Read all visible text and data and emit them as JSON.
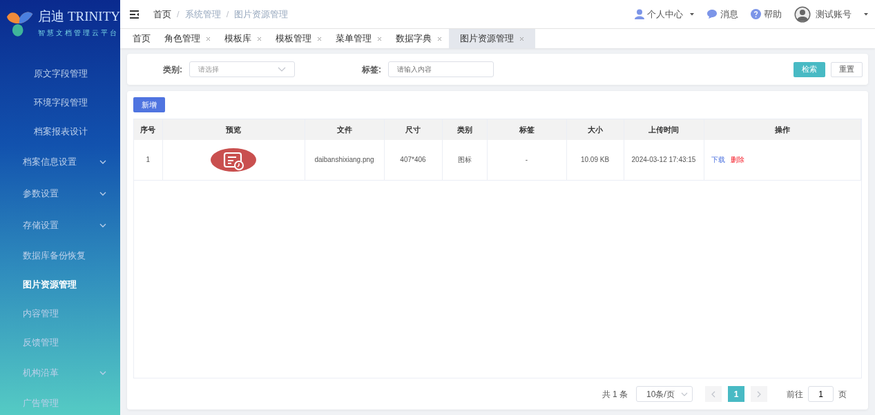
{
  "logo": {
    "name": "启迪",
    "brand": "TRINITY",
    "subtitle": "智慧文档管理云平台"
  },
  "sidebar": {
    "items": [
      {
        "label": "原文字段管理",
        "kind": "child",
        "selected": false
      },
      {
        "label": "环境字段管理",
        "kind": "child",
        "selected": false
      },
      {
        "label": "档案报表设计",
        "kind": "child",
        "selected": false
      },
      {
        "label": "档案信息设置",
        "kind": "parent",
        "selected": false
      },
      {
        "label": "参数设置",
        "kind": "parent",
        "selected": false
      },
      {
        "label": "存储设置",
        "kind": "parent",
        "selected": false
      },
      {
        "label": "数据库备份恢复",
        "kind": "link",
        "selected": false
      },
      {
        "label": "图片资源管理",
        "kind": "link",
        "selected": true
      },
      {
        "label": "内容管理",
        "kind": "link",
        "selected": false
      },
      {
        "label": "反馈管理",
        "kind": "link",
        "selected": false
      },
      {
        "label": "机构沿革",
        "kind": "parent",
        "selected": false
      },
      {
        "label": "广告管理",
        "kind": "link",
        "selected": false
      }
    ]
  },
  "breadcrumb_separator": "/",
  "breadcrumb": [
    {
      "label": "首页",
      "current": false
    },
    {
      "label": "系统管理",
      "current": true
    },
    {
      "label": "图片资源管理",
      "current": true
    }
  ],
  "user_menu": [
    {
      "kind": "person",
      "label": "个人中心",
      "dropdown": true
    },
    {
      "kind": "message",
      "label": "消息",
      "dropdown": false
    },
    {
      "kind": "help",
      "label": "帮助",
      "dropdown": false
    },
    {
      "kind": "account",
      "label": "测试账号",
      "dropdown": true
    }
  ],
  "tabs": [
    {
      "label": "首页",
      "closable": false,
      "selected": false
    },
    {
      "label": "角色管理",
      "closable": true,
      "selected": false
    },
    {
      "label": "模板库",
      "closable": true,
      "selected": false
    },
    {
      "label": "模板管理",
      "closable": true,
      "selected": false
    },
    {
      "label": "菜单管理",
      "closable": true,
      "selected": false
    },
    {
      "label": "数据字典",
      "closable": true,
      "selected": false
    },
    {
      "label": "图片资源管理",
      "closable": true,
      "selected": true
    }
  ],
  "filters": [
    {
      "kind": "select",
      "label": "类别:",
      "placeholder": "请选择"
    },
    {
      "kind": "text",
      "label": "标签:",
      "placeholder": "请输入内容"
    }
  ],
  "search_button": "检索",
  "reset_button": "重置",
  "add_button": "新增",
  "table": {
    "columns": [
      "序号",
      "预览",
      "文件",
      "尺寸",
      "类别",
      "标签",
      "大小",
      "上传时间",
      "操作"
    ],
    "rows": [
      {
        "index": "1",
        "file": "daibanshixiang.png",
        "dimensions": "407*406",
        "category": "图标",
        "tag": "-",
        "file_size": "10.09 KB",
        "uploaded": "2024-03-12 17:43:15",
        "actions": [
          {
            "kind": "download",
            "label": "下载"
          },
          {
            "kind": "delete",
            "label": "删除"
          }
        ]
      }
    ]
  },
  "pagination": {
    "total": "共 1 条",
    "page_size": "10条/页",
    "pages": [
      {
        "label": "1",
        "selected": true
      }
    ],
    "goto_label": "前往",
    "goto_value": "1",
    "page_unit": "页"
  }
}
